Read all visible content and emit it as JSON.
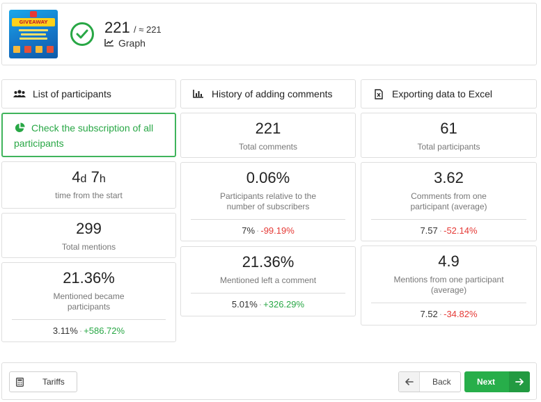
{
  "header": {
    "thumbnail_text": "GIVEAWAY",
    "count": "221",
    "count_approx": "/ ≈ 221",
    "graph_label": "Graph"
  },
  "tabs": {
    "participants": "List of participants",
    "history": "History of adding comments",
    "export": "Exporting data to Excel"
  },
  "check_subscription": "Check the subscription of all participants",
  "time_from_start": {
    "days": "4",
    "days_unit": "d",
    "hours": "7",
    "hours_unit": "h",
    "label": "time from the start"
  },
  "total_mentions": {
    "value": "299",
    "label": "Total mentions"
  },
  "mentioned_became": {
    "value": "21.36%",
    "label": "Mentioned became participants",
    "cmp_base": "3.11%",
    "cmp_delta": "+586.72%"
  },
  "total_comments": {
    "value": "221",
    "label": "Total comments"
  },
  "participants_relative": {
    "value": "0.06%",
    "label": "Participants relative to the number of subscribers",
    "cmp_base": "7%",
    "cmp_delta": "-99.19%"
  },
  "mentioned_left": {
    "value": "21.36%",
    "label": "Mentioned left a comment",
    "cmp_base": "5.01%",
    "cmp_delta": "+326.29%"
  },
  "total_participants": {
    "value": "61",
    "label": "Total participants"
  },
  "comments_per_participant": {
    "value": "3.62",
    "label": "Comments from one participant (average)",
    "cmp_base": "7.57",
    "cmp_delta": "-52.14%"
  },
  "mentions_per_participant": {
    "value": "4.9",
    "label": "Mentions from one participant (average)",
    "cmp_base": "7.52",
    "cmp_delta": "-34.82%"
  },
  "footer": {
    "tariffs": "Tariffs",
    "back": "Back",
    "next": "Next"
  },
  "colors": {
    "accent_green": "#28a745",
    "negative_red": "#e53935"
  },
  "icons": [
    "check-circle-icon",
    "chart-line-icon",
    "users-icon",
    "bar-chart-icon",
    "excel-file-icon",
    "pie-chart-icon",
    "calculator-icon",
    "arrow-left-icon",
    "arrow-right-icon"
  ]
}
